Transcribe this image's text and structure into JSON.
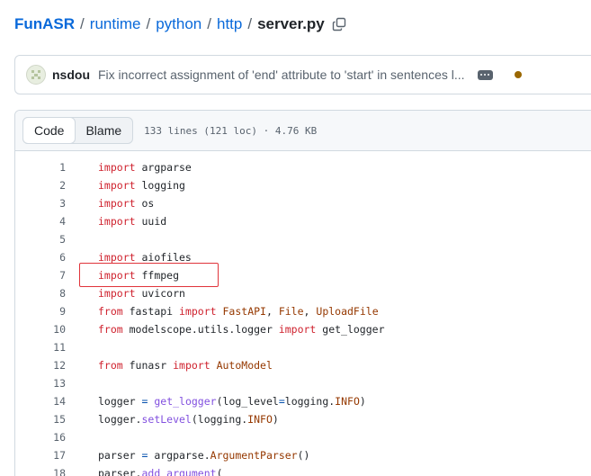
{
  "breadcrumb": {
    "repo": "FunASR",
    "segments": [
      "runtime",
      "python",
      "http"
    ],
    "separator": "/",
    "file": "server.py"
  },
  "commit": {
    "author": "nsdou",
    "message": "Fix incorrect assignment of 'end' attribute to 'start' in sentences l..."
  },
  "file_view": {
    "tabs": [
      {
        "label": "Code",
        "active": true
      },
      {
        "label": "Blame",
        "active": false
      }
    ],
    "meta": "133 lines (121 loc) · 4.76 KB"
  },
  "code_lines": [
    {
      "n": "1",
      "tokens": [
        {
          "t": "import",
          "c": "kw"
        },
        {
          "t": " argparse",
          "c": ""
        }
      ]
    },
    {
      "n": "2",
      "tokens": [
        {
          "t": "import",
          "c": "kw"
        },
        {
          "t": " logging",
          "c": ""
        }
      ]
    },
    {
      "n": "3",
      "tokens": [
        {
          "t": "import",
          "c": "kw"
        },
        {
          "t": " os",
          "c": ""
        }
      ]
    },
    {
      "n": "4",
      "tokens": [
        {
          "t": "import",
          "c": "kw"
        },
        {
          "t": " uuid",
          "c": ""
        }
      ]
    },
    {
      "n": "5",
      "tokens": []
    },
    {
      "n": "6",
      "tokens": [
        {
          "t": "import",
          "c": "kw"
        },
        {
          "t": " aiofiles",
          "c": ""
        }
      ]
    },
    {
      "n": "7",
      "tokens": [
        {
          "t": "import",
          "c": "kw"
        },
        {
          "t": " ffmpeg",
          "c": ""
        }
      ]
    },
    {
      "n": "8",
      "tokens": [
        {
          "t": "import",
          "c": "kw"
        },
        {
          "t": " uvicorn",
          "c": ""
        }
      ]
    },
    {
      "n": "9",
      "tokens": [
        {
          "t": "from",
          "c": "kw"
        },
        {
          "t": " fastapi ",
          "c": ""
        },
        {
          "t": "import",
          "c": "kw"
        },
        {
          "t": " ",
          "c": ""
        },
        {
          "t": "FastAPI",
          "c": "cls"
        },
        {
          "t": ", ",
          "c": ""
        },
        {
          "t": "File",
          "c": "cls"
        },
        {
          "t": ", ",
          "c": ""
        },
        {
          "t": "UploadFile",
          "c": "cls"
        }
      ]
    },
    {
      "n": "10",
      "tokens": [
        {
          "t": "from",
          "c": "kw"
        },
        {
          "t": " modelscope.utils.logger ",
          "c": ""
        },
        {
          "t": "import",
          "c": "kw"
        },
        {
          "t": " get_logger",
          "c": ""
        }
      ]
    },
    {
      "n": "11",
      "tokens": []
    },
    {
      "n": "12",
      "tokens": [
        {
          "t": "from",
          "c": "kw"
        },
        {
          "t": " funasr ",
          "c": ""
        },
        {
          "t": "import",
          "c": "kw"
        },
        {
          "t": " ",
          "c": ""
        },
        {
          "t": "AutoModel",
          "c": "cls"
        }
      ]
    },
    {
      "n": "13",
      "tokens": []
    },
    {
      "n": "14",
      "tokens": [
        {
          "t": "logger ",
          "c": ""
        },
        {
          "t": "=",
          "c": "op"
        },
        {
          "t": " ",
          "c": ""
        },
        {
          "t": "get_logger",
          "c": "fn"
        },
        {
          "t": "(log_level",
          "c": ""
        },
        {
          "t": "=",
          "c": "op"
        },
        {
          "t": "logging.",
          "c": ""
        },
        {
          "t": "INFO",
          "c": "cls"
        },
        {
          "t": ")",
          "c": ""
        }
      ]
    },
    {
      "n": "15",
      "tokens": [
        {
          "t": "logger.",
          "c": ""
        },
        {
          "t": "setLevel",
          "c": "fn"
        },
        {
          "t": "(logging.",
          "c": ""
        },
        {
          "t": "INFO",
          "c": "cls"
        },
        {
          "t": ")",
          "c": ""
        }
      ]
    },
    {
      "n": "16",
      "tokens": []
    },
    {
      "n": "17",
      "tokens": [
        {
          "t": "parser ",
          "c": ""
        },
        {
          "t": "=",
          "c": "op"
        },
        {
          "t": " argparse.",
          "c": ""
        },
        {
          "t": "ArgumentParser",
          "c": "cls"
        },
        {
          "t": "()",
          "c": ""
        }
      ]
    },
    {
      "n": "18",
      "tokens": [
        {
          "t": "parser.",
          "c": ""
        },
        {
          "t": "add_argument",
          "c": "fn"
        },
        {
          "t": "(",
          "c": ""
        }
      ]
    }
  ],
  "highlighted_line": "7",
  "icons": {
    "copy": "copy-icon",
    "more": "kebab-horizontal-icon",
    "status": "status-dot-icon"
  },
  "colors": {
    "link": "#0969da",
    "keyword": "#cf222e",
    "highlight_box": "#e0343a",
    "status_dot": "#9a6700"
  }
}
